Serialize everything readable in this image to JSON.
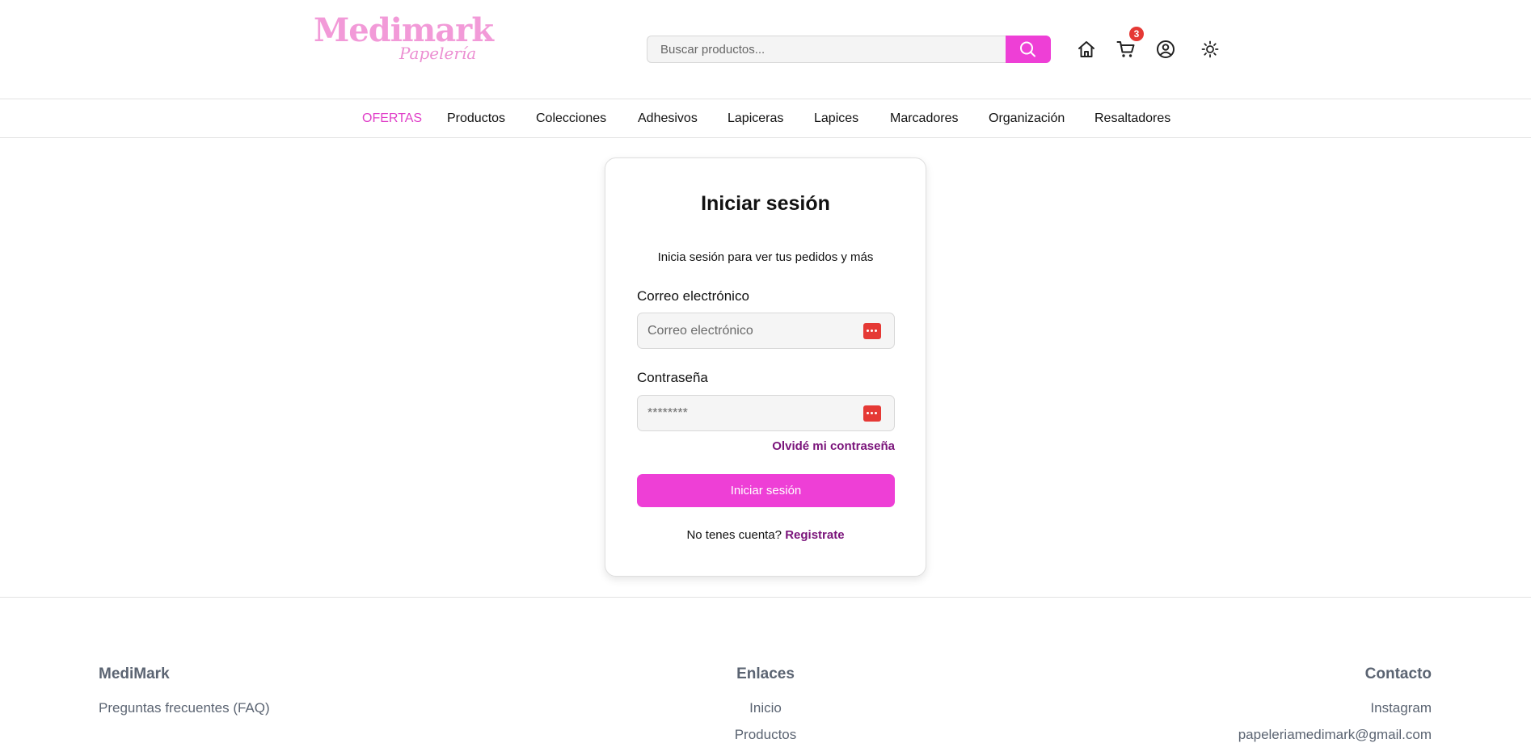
{
  "header": {
    "logo": {
      "brand": "Medimark",
      "tagline": "Papelería"
    },
    "search": {
      "placeholder": "Buscar productos..."
    },
    "cart_count": "3",
    "icons": [
      "home-icon",
      "cart-icon",
      "user-icon",
      "sun-icon",
      "search-icon"
    ]
  },
  "nav": {
    "items": [
      {
        "label": "OFERTAS"
      },
      {
        "label": "Productos"
      },
      {
        "label": "Colecciones"
      },
      {
        "label": "Adhesivos"
      },
      {
        "label": "Lapiceras"
      },
      {
        "label": "Lapices"
      },
      {
        "label": "Marcadores"
      },
      {
        "label": "Organización"
      },
      {
        "label": "Resaltadores"
      }
    ]
  },
  "login": {
    "title": "Iniciar sesión",
    "subtitle": "Inicia sesión para ver tus pedidos y más",
    "email_label": "Correo electrónico",
    "email_placeholder": "Correo electrónico",
    "password_label": "Contraseña",
    "password_placeholder": "********",
    "forgot": "Olvidé mi contraseña",
    "submit": "Iniciar sesión",
    "no_account": "No tenes cuenta?",
    "register": "Registrate"
  },
  "footer": {
    "col1": {
      "title": "MediMark",
      "links": [
        "Preguntas frecuentes (FAQ)"
      ]
    },
    "col2": {
      "title": "Enlaces",
      "links": [
        "Inicio",
        "Productos"
      ]
    },
    "col3": {
      "title": "Contacto",
      "links": [
        "Instagram",
        "papeleriamedimark@gmail.com"
      ]
    }
  },
  "colors": {
    "accent": "#ee3fd6",
    "offer": "#e03fc8",
    "link": "#7a137a",
    "badge": "#e53935",
    "footer_text": "#5b6472"
  }
}
